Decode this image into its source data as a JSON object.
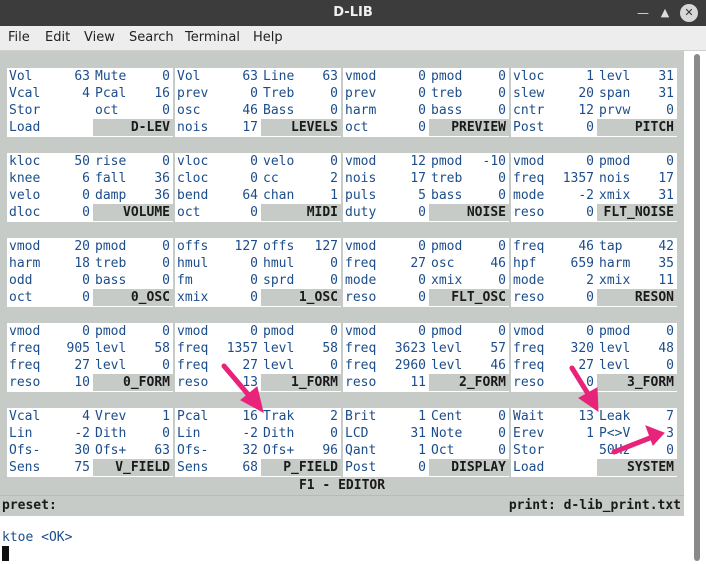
{
  "window": {
    "title": "D-LIB"
  },
  "menu": [
    "File",
    "Edit",
    "View",
    "Search",
    "Terminal",
    "Help"
  ],
  "panels": [
    {
      "title": "D-LEV",
      "cells": [
        [
          "Vol",
          "63"
        ],
        [
          "Mute",
          "0"
        ],
        [
          "Vcal",
          "4"
        ],
        [
          "Pcal",
          "16"
        ],
        [
          "Stor",
          ""
        ],
        [
          "oct",
          "0"
        ],
        [
          "Load",
          ""
        ]
      ]
    },
    {
      "title": "LEVELS",
      "cells": [
        [
          "Vol",
          "63"
        ],
        [
          "Line",
          "63"
        ],
        [
          "prev",
          "0"
        ],
        [
          "Treb",
          "0"
        ],
        [
          "osc",
          "46"
        ],
        [
          "Bass",
          "0"
        ],
        [
          "nois",
          "17"
        ]
      ]
    },
    {
      "title": "PREVIEW",
      "cells": [
        [
          "vmod",
          "0"
        ],
        [
          "pmod",
          "0"
        ],
        [
          "prev",
          "0"
        ],
        [
          "treb",
          "0"
        ],
        [
          "harm",
          "0"
        ],
        [
          "bass",
          "0"
        ],
        [
          "oct",
          "0"
        ]
      ]
    },
    {
      "title": "PITCH",
      "cells": [
        [
          "vloc",
          "1"
        ],
        [
          "levl",
          "31"
        ],
        [
          "slew",
          "20"
        ],
        [
          "span",
          "31"
        ],
        [
          "cntr",
          "12"
        ],
        [
          "prvw",
          "0"
        ],
        [
          "Post",
          "0"
        ]
      ]
    },
    {
      "title": "VOLUME",
      "cells": [
        [
          "kloc",
          "50"
        ],
        [
          "rise",
          "0"
        ],
        [
          "knee",
          "6"
        ],
        [
          "fall",
          "36"
        ],
        [
          "velo",
          "0"
        ],
        [
          "damp",
          "36"
        ],
        [
          "dloc",
          "0"
        ]
      ]
    },
    {
      "title": "MIDI",
      "cells": [
        [
          "vloc",
          "0"
        ],
        [
          "velo",
          "0"
        ],
        [
          "cloc",
          "0"
        ],
        [
          "cc",
          "2"
        ],
        [
          "bend",
          "64"
        ],
        [
          "chan",
          "1"
        ],
        [
          "oct",
          "0"
        ]
      ]
    },
    {
      "title": "NOISE",
      "cells": [
        [
          "vmod",
          "12"
        ],
        [
          "pmod",
          "-10"
        ],
        [
          "nois",
          "17"
        ],
        [
          "treb",
          "0"
        ],
        [
          "puls",
          "5"
        ],
        [
          "bass",
          "0"
        ],
        [
          "duty",
          "0"
        ]
      ]
    },
    {
      "title": "FLT_NOISE",
      "cells": [
        [
          "vmod",
          "0"
        ],
        [
          "pmod",
          "0"
        ],
        [
          "freq",
          "1357"
        ],
        [
          "nois",
          "17"
        ],
        [
          "mode",
          "-2"
        ],
        [
          "xmix",
          "31"
        ],
        [
          "reso",
          "0"
        ]
      ]
    },
    {
      "title": "0_OSC",
      "cells": [
        [
          "vmod",
          "20"
        ],
        [
          "pmod",
          "0"
        ],
        [
          "harm",
          "18"
        ],
        [
          "treb",
          "0"
        ],
        [
          "odd",
          "0"
        ],
        [
          "bass",
          "0"
        ],
        [
          "oct",
          "0"
        ]
      ]
    },
    {
      "title": "1_OSC",
      "cells": [
        [
          "offs",
          "127"
        ],
        [
          "offs",
          "127"
        ],
        [
          "hmul",
          "0"
        ],
        [
          "hmul",
          "0"
        ],
        [
          "fm",
          "0"
        ],
        [
          "sprd",
          "0"
        ],
        [
          "xmix",
          "0"
        ]
      ]
    },
    {
      "title": "FLT_OSC",
      "cells": [
        [
          "vmod",
          "0"
        ],
        [
          "pmod",
          "0"
        ],
        [
          "freq",
          "27"
        ],
        [
          "osc",
          "46"
        ],
        [
          "mode",
          "0"
        ],
        [
          "xmix",
          "0"
        ],
        [
          "reso",
          "0"
        ]
      ]
    },
    {
      "title": "RESON",
      "cells": [
        [
          "freq",
          "46"
        ],
        [
          "tap",
          "42"
        ],
        [
          "hpf",
          "659"
        ],
        [
          "harm",
          "35"
        ],
        [
          "mode",
          "2"
        ],
        [
          "xmix",
          "11"
        ],
        [
          "reso",
          "0"
        ]
      ]
    },
    {
      "title": "0_FORM",
      "cells": [
        [
          "vmod",
          "0"
        ],
        [
          "pmod",
          "0"
        ],
        [
          "freq",
          "905"
        ],
        [
          "levl",
          "58"
        ],
        [
          "freq",
          "27"
        ],
        [
          "levl",
          "0"
        ],
        [
          "reso",
          "10"
        ]
      ]
    },
    {
      "title": "1_FORM",
      "cells": [
        [
          "vmod",
          "0"
        ],
        [
          "pmod",
          "0"
        ],
        [
          "freq",
          "1357"
        ],
        [
          "levl",
          "58"
        ],
        [
          "freq",
          "27"
        ],
        [
          "levl",
          "0"
        ],
        [
          "reso",
          "13"
        ]
      ]
    },
    {
      "title": "2_FORM",
      "cells": [
        [
          "vmod",
          "0"
        ],
        [
          "pmod",
          "0"
        ],
        [
          "freq",
          "3623"
        ],
        [
          "levl",
          "57"
        ],
        [
          "freq",
          "2960"
        ],
        [
          "levl",
          "46"
        ],
        [
          "reso",
          "11"
        ]
      ]
    },
    {
      "title": "3_FORM",
      "cells": [
        [
          "vmod",
          "0"
        ],
        [
          "pmod",
          "0"
        ],
        [
          "freq",
          "320"
        ],
        [
          "levl",
          "48"
        ],
        [
          "freq",
          "27"
        ],
        [
          "levl",
          "0"
        ],
        [
          "reso",
          "0"
        ]
      ]
    },
    {
      "title": "V_FIELD",
      "cells": [
        [
          "Vcal",
          "4"
        ],
        [
          "Vrev",
          "1"
        ],
        [
          "Lin",
          "-2"
        ],
        [
          "Dith",
          "0"
        ],
        [
          "Ofs-",
          "30"
        ],
        [
          "Ofs+",
          "63"
        ],
        [
          "Sens",
          "75"
        ]
      ]
    },
    {
      "title": "P_FIELD",
      "cells": [
        [
          "Pcal",
          "16"
        ],
        [
          "Trak",
          "2"
        ],
        [
          "Lin",
          "-2"
        ],
        [
          "Dith",
          "0"
        ],
        [
          "Ofs-",
          "32"
        ],
        [
          "Ofs+",
          "96"
        ],
        [
          "Sens",
          "68"
        ]
      ]
    },
    {
      "title": "DISPLAY",
      "cells": [
        [
          "Brit",
          "1"
        ],
        [
          "Cent",
          "0"
        ],
        [
          "LCD",
          "31"
        ],
        [
          "Note",
          "0"
        ],
        [
          "Qant",
          "1"
        ],
        [
          "Oct",
          "0"
        ],
        [
          "Post",
          "0"
        ]
      ]
    },
    {
      "title": "SYSTEM",
      "cells": [
        [
          "Wait",
          "13"
        ],
        [
          "Leak",
          "7"
        ],
        [
          "Erev",
          "1"
        ],
        [
          "P<>V",
          "3"
        ],
        [
          "Stor",
          ""
        ],
        [
          "50Hz",
          "0"
        ],
        [
          "Load",
          ""
        ]
      ]
    }
  ],
  "footer_title": "F1 - EDITOR",
  "status": {
    "preset_label": "preset:",
    "print_label": "print: d-lib_print.txt"
  },
  "output_line": "ktoe <OK>",
  "colors": {
    "label_text": "#1c4d8a",
    "grid_bg": "#c7cbc7",
    "arrow": "#e8247a"
  }
}
